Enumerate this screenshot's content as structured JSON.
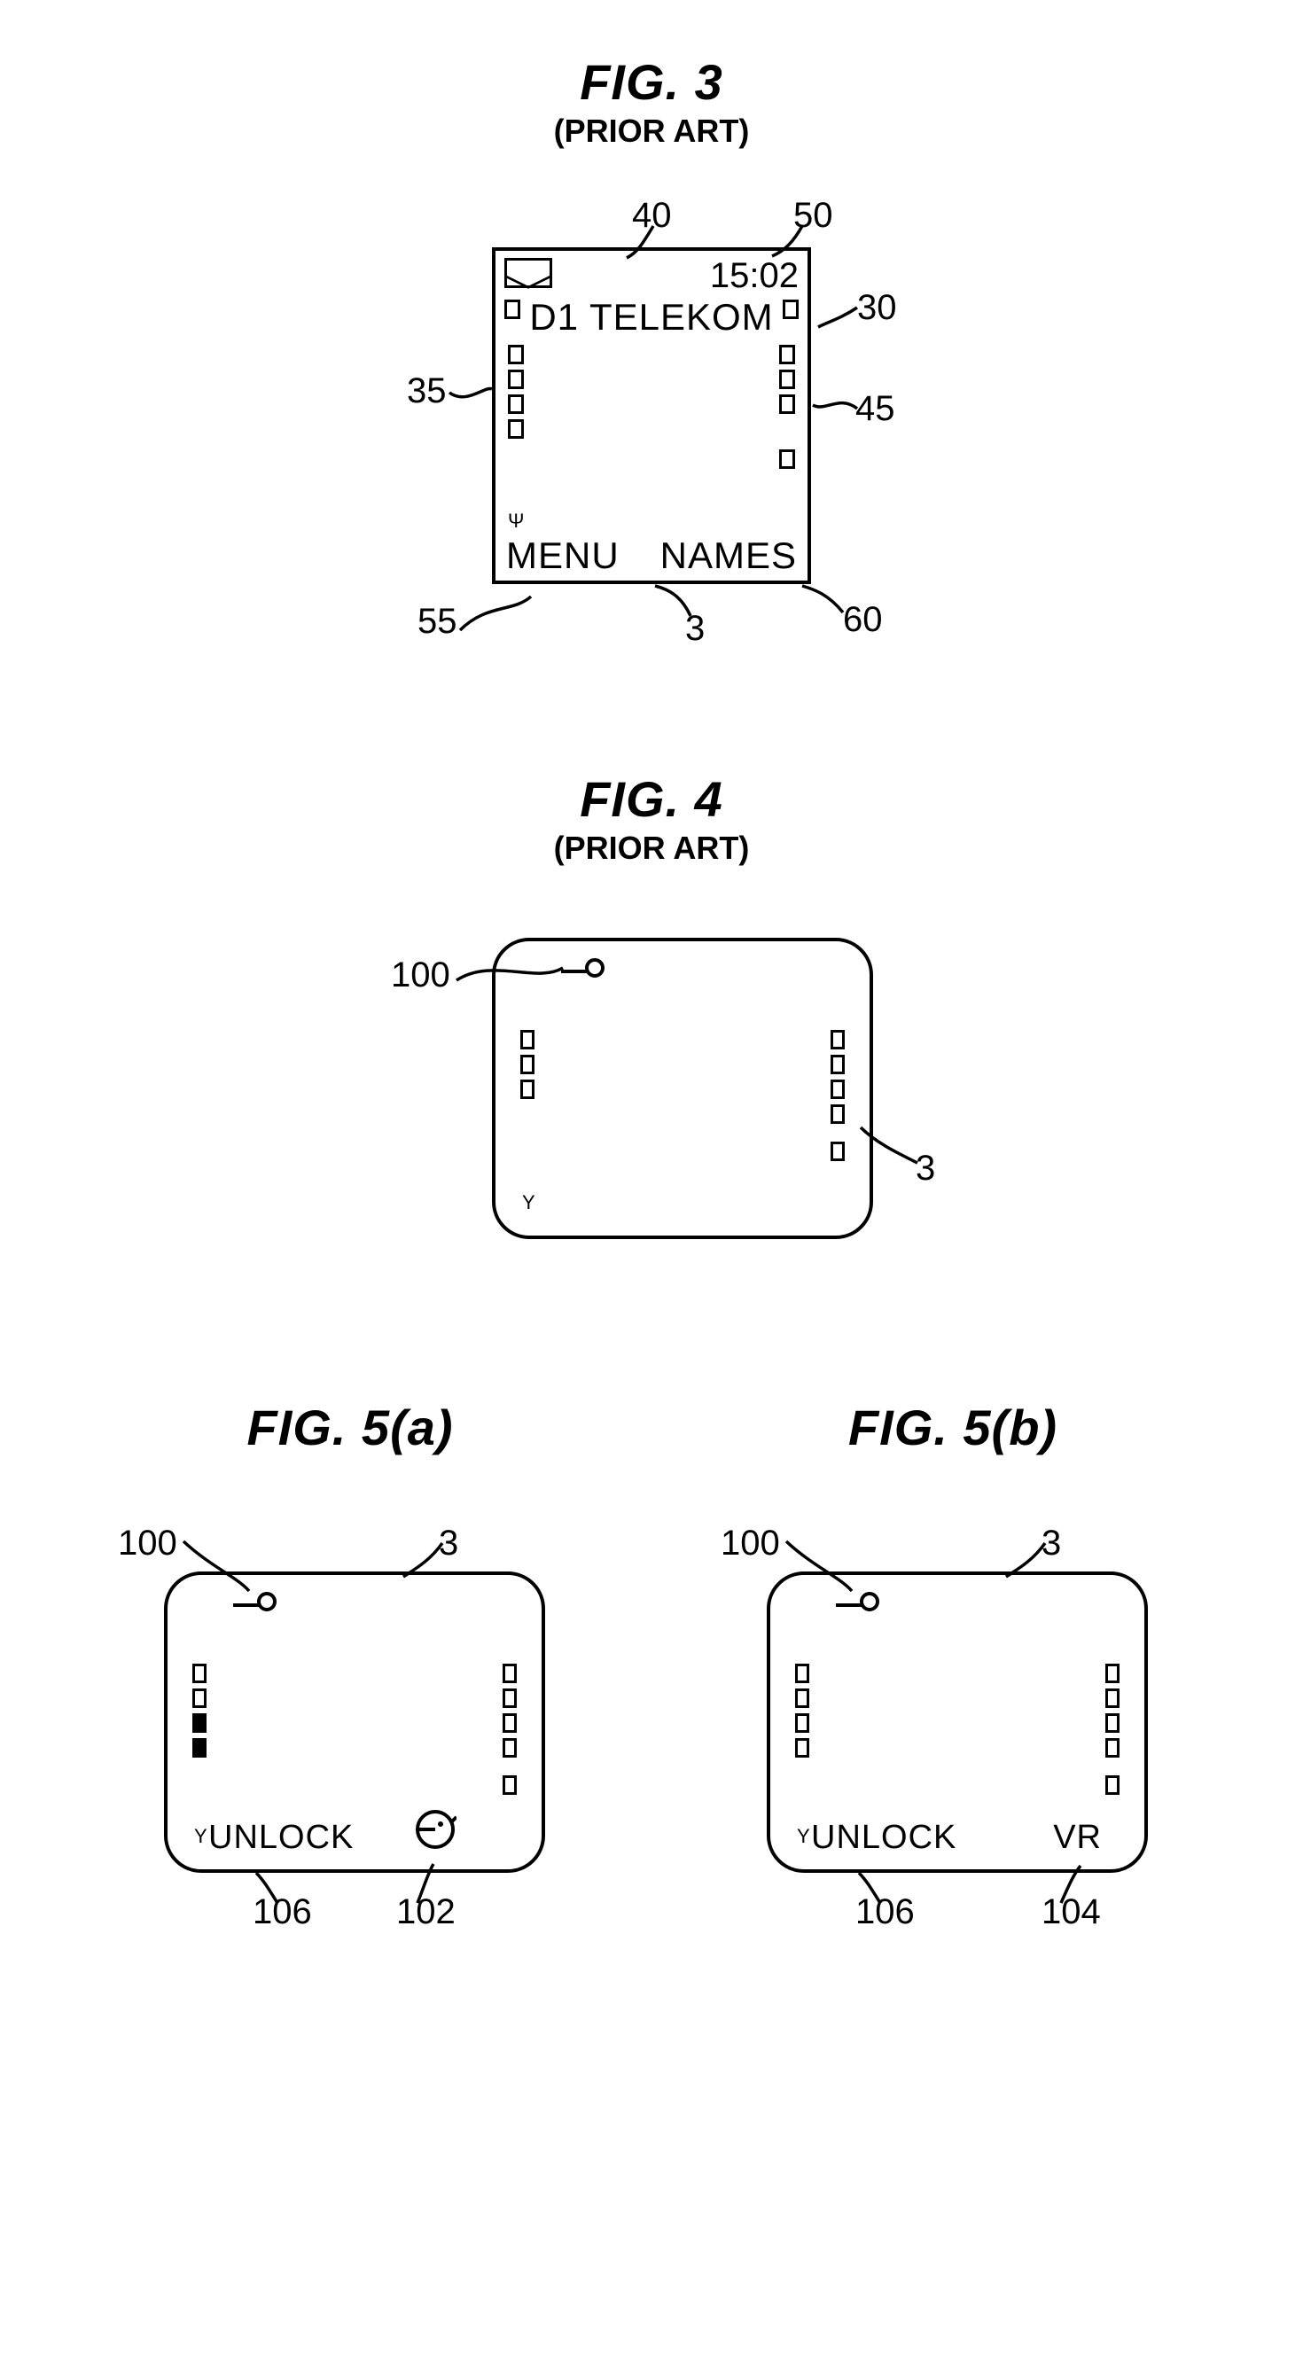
{
  "fig3": {
    "title": "FIG. 3",
    "subtitle": "(PRIOR ART)",
    "screen": {
      "time": "15:02",
      "carrier": "D1 TELEKOM",
      "menu": "MENU",
      "names": "NAMES"
    },
    "callouts": {
      "l35": "35",
      "l55": "55",
      "l40": "40",
      "l50": "50",
      "l30": "30",
      "l45": "45",
      "l3": "3",
      "l60": "60"
    }
  },
  "fig4": {
    "title": "FIG. 4",
    "subtitle": "(PRIOR ART)",
    "callouts": {
      "l100": "100",
      "l3": "3"
    }
  },
  "fig5a": {
    "title": "FIG. 5(a)",
    "screen": {
      "unlock": "UNLOCK"
    },
    "callouts": {
      "l100": "100",
      "l3": "3",
      "l106": "106",
      "l102": "102"
    }
  },
  "fig5b": {
    "title": "FIG. 5(b)",
    "screen": {
      "unlock": "UNLOCK",
      "vr": "VR"
    },
    "callouts": {
      "l100": "100",
      "l3": "3",
      "l106": "106",
      "l104": "104"
    }
  }
}
